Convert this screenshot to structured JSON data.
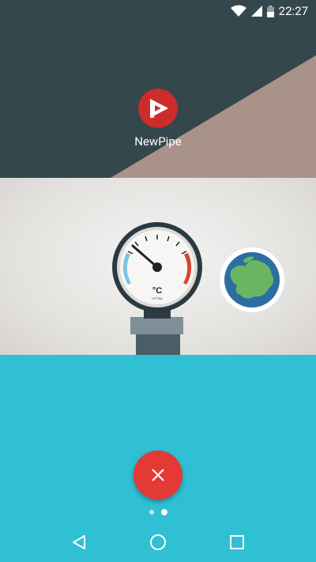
{
  "status_bar": {
    "time": "22:27",
    "icons": [
      "wifi-icon",
      "cell-signal-icon",
      "battery-icon"
    ]
  },
  "home": {
    "app_label": "NewPipe",
    "app_icon": "newpipe-app-icon"
  },
  "illustration": {
    "gauge_unit": "°C",
    "gauge_brand": "OFTBA",
    "globe": "europe-globe-icon"
  },
  "controls": {
    "fab_icon": "close-icon",
    "pager_dots": 2,
    "active_dot": 1
  },
  "nav_bar": {
    "buttons": [
      "back-icon",
      "home-icon",
      "recents-icon"
    ]
  },
  "colors": {
    "home_background": "#34474d",
    "diagonal_panel": "#a8928a",
    "bottom_background": "#2fc0d3",
    "fab": "#e53935",
    "app_icon": "#cd2c2c"
  }
}
